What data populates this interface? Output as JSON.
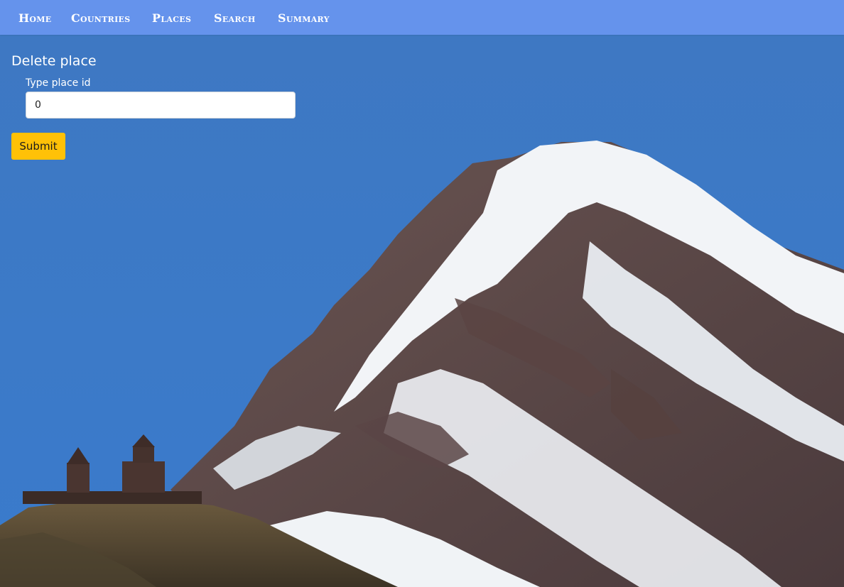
{
  "nav": {
    "items": [
      {
        "label": "Home"
      },
      {
        "label": "Countries"
      },
      {
        "label": "Places"
      },
      {
        "label": "Search"
      },
      {
        "label": "Summary"
      }
    ]
  },
  "form": {
    "title": "Delete place",
    "field_label": "Type place id",
    "input_value": "0",
    "submit_label": "Submit"
  },
  "colors": {
    "navbar": "#6593ec",
    "sky": "#3b7ac7",
    "submit_button": "#ffc107"
  },
  "background": {
    "description_icon": "mountain-landscape-image"
  }
}
